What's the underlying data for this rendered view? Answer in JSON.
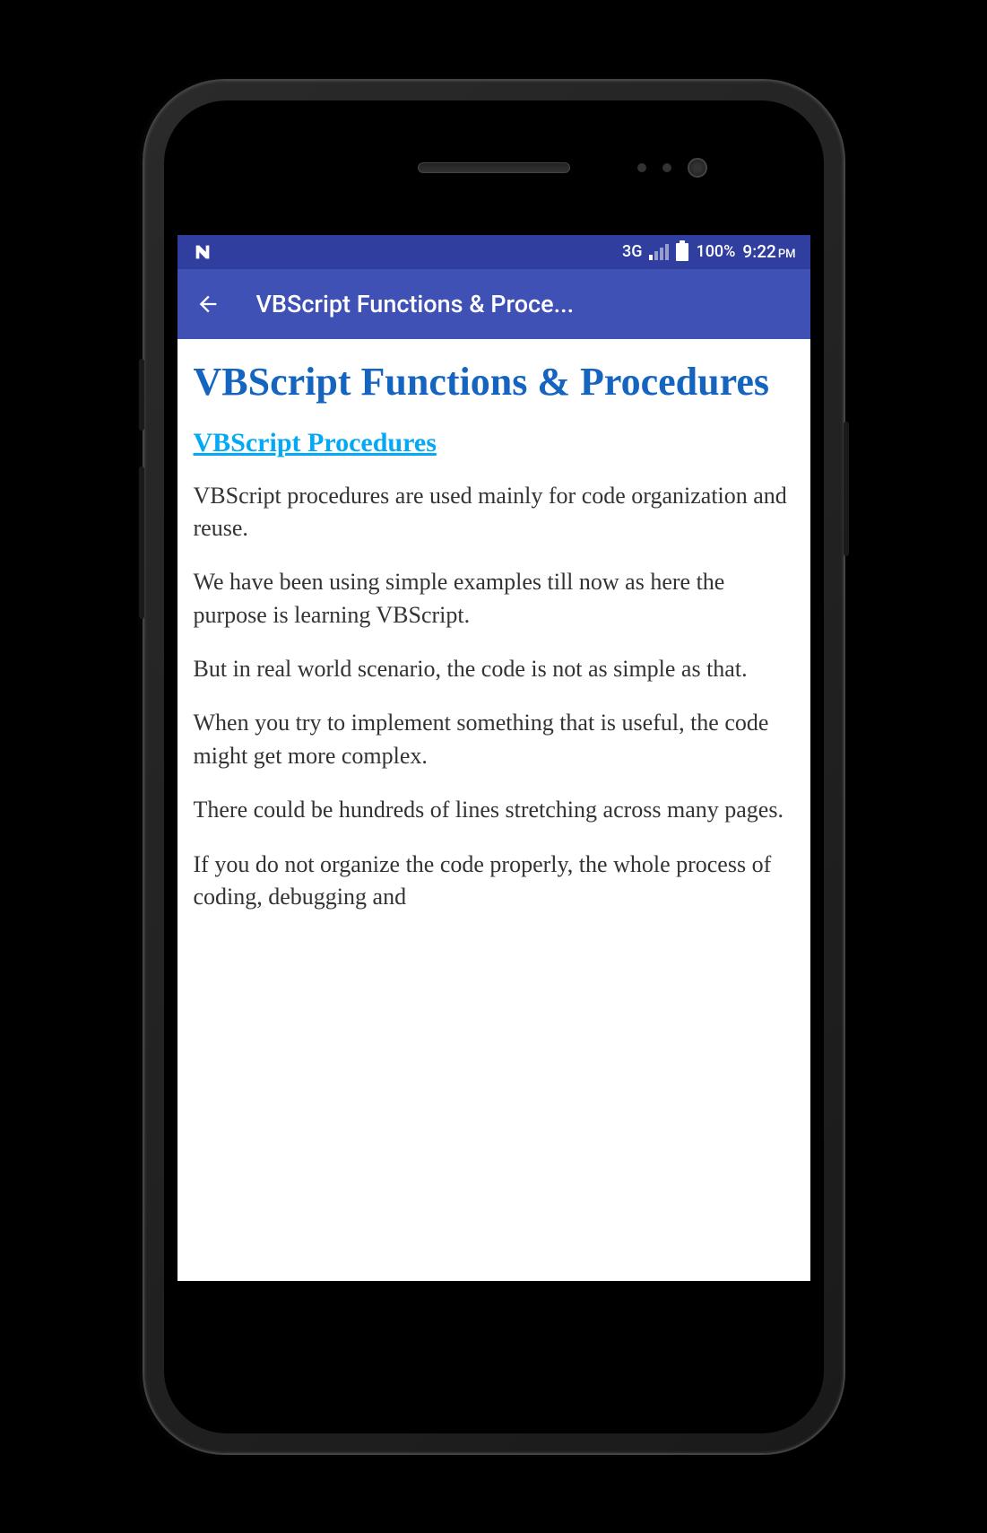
{
  "statusBar": {
    "networkType": "3G",
    "batteryPercent": "100%",
    "time": "9:22",
    "timePeriod": "PM"
  },
  "appBar": {
    "title": "VBScript Functions & Proce..."
  },
  "content": {
    "mainHeading": "VBScript Functions & Procedures",
    "subHeading": "VBScript Procedures",
    "paragraphs": [
      "VBScript procedures are used mainly for code organization and reuse.",
      "We have been using simple examples till now as here the purpose is learning VBScript.",
      "But in real world scenario, the code is not as simple as that.",
      "When you try to implement something that is useful, the code might get more complex.",
      "There could be hundreds of lines stretching across many pages.",
      "If you do not organize the code properly, the whole process of coding, debugging and"
    ]
  }
}
